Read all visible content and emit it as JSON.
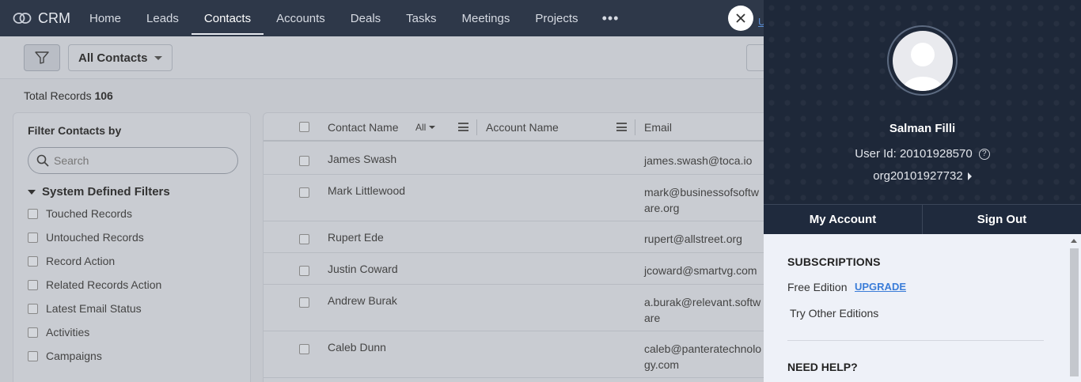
{
  "app": {
    "name": "CRM"
  },
  "nav": {
    "items": [
      {
        "label": "Home"
      },
      {
        "label": "Leads"
      },
      {
        "label": "Contacts"
      },
      {
        "label": "Accounts"
      },
      {
        "label": "Deals"
      },
      {
        "label": "Tasks"
      },
      {
        "label": "Meetings"
      },
      {
        "label": "Projects"
      }
    ],
    "more": "•••",
    "active": "Contacts",
    "partial_link": "U"
  },
  "toolbar": {
    "view": "All Contacts"
  },
  "summary": {
    "total_label": "Total Records",
    "total_count": "106"
  },
  "filters": {
    "title": "Filter Contacts by",
    "search_placeholder": "Search",
    "section": "System Defined Filters",
    "items": [
      {
        "label": "Touched Records"
      },
      {
        "label": "Untouched Records"
      },
      {
        "label": "Record Action"
      },
      {
        "label": "Related Records Action"
      },
      {
        "label": "Latest Email Status"
      },
      {
        "label": "Activities"
      },
      {
        "label": "Campaigns"
      }
    ]
  },
  "table": {
    "columns": {
      "contact_name": "Contact Name",
      "all": "All",
      "account_name": "Account Name",
      "email": "Email"
    },
    "rows": [
      {
        "name": "James Swash",
        "email": "james.swash@toca.io"
      },
      {
        "name": "Mark Littlewood",
        "email": "mark@businessofsoftware.org"
      },
      {
        "name": "Rupert Ede",
        "email": "rupert@allstreet.org"
      },
      {
        "name": "Justin Coward",
        "email": "jcoward@smartvg.com"
      },
      {
        "name": "Andrew Burak",
        "email": "a.burak@relevant.software"
      },
      {
        "name": "Caleb Dunn",
        "email": "caleb@panteratechnology.com"
      }
    ]
  },
  "profile": {
    "name": "Salman Filli",
    "user_id": "User Id: 20101928570",
    "help_glyph": "?",
    "org": "org20101927732",
    "my_account": "My Account",
    "sign_out": "Sign Out",
    "subscriptions_title": "SUBSCRIPTIONS",
    "edition": "Free Edition",
    "upgrade": "UPGRADE",
    "try_other": "Try Other Editions",
    "need_help": "NEED HELP?"
  },
  "colors": {
    "topbar": "#2e3849",
    "profile_bg": "#1e2839",
    "link": "#3b7dd8"
  }
}
